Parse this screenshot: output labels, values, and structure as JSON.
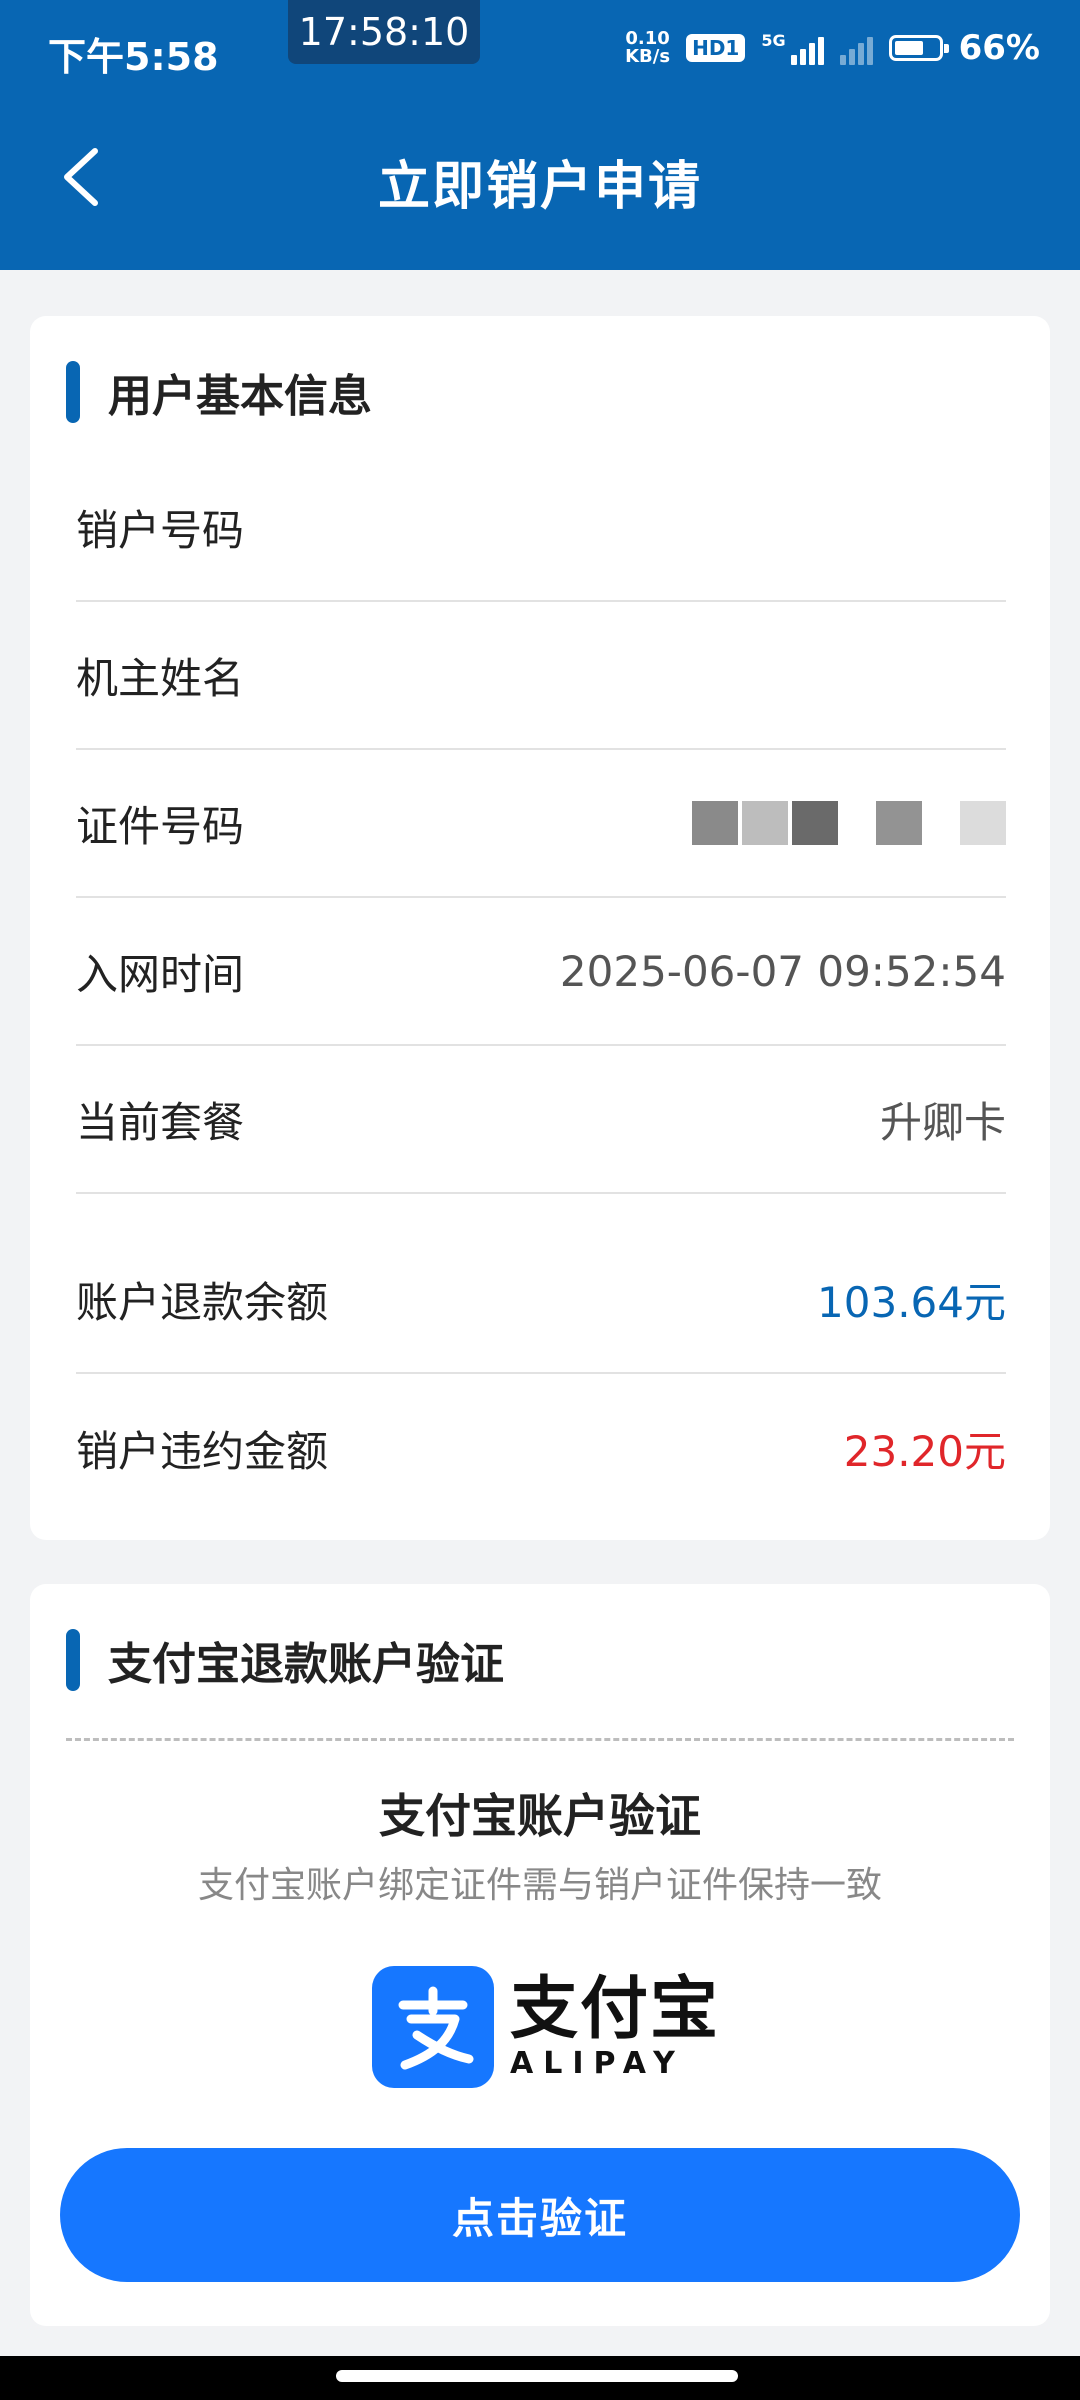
{
  "status_bar": {
    "time": "下午5:58",
    "clock_overlay": "17:58:10",
    "net_speed_value": "0.10",
    "net_speed_unit": "KB/s",
    "hd_label": "HD1",
    "network_label": "5G",
    "battery_text": "66%",
    "battery_level": 0.66
  },
  "header": {
    "title": "立即销户申请",
    "back_icon": "chevron-left-icon"
  },
  "user_info": {
    "section_title": "用户基本信息",
    "rows": [
      {
        "label": "销户号码",
        "value": ""
      },
      {
        "label": "机主姓名",
        "value": ""
      },
      {
        "label": "证件号码",
        "value": ""
      },
      {
        "label": "入网时间",
        "value": "2025-06-07 09:52:54"
      },
      {
        "label": "当前套餐",
        "value": "升卿卡"
      },
      {
        "label": "账户退款余额",
        "value": "103.64元"
      },
      {
        "label": "销户违约金额",
        "value": "23.20元"
      }
    ]
  },
  "alipay_section": {
    "section_title": "支付宝退款账户验证",
    "verify_title": "支付宝账户验证",
    "verify_subtitle": "支付宝账户绑定证件需与销户证件保持一致",
    "logo_cn": "支付宝",
    "logo_en": "ALIPAY",
    "logo_icon": "alipay-logo-icon",
    "button_label": "点击验证"
  },
  "colors": {
    "header_blue": "#0866b3",
    "accent_blue": "#1677ff",
    "refund_blue": "#0866b3",
    "penalty_red": "#e0262a"
  }
}
